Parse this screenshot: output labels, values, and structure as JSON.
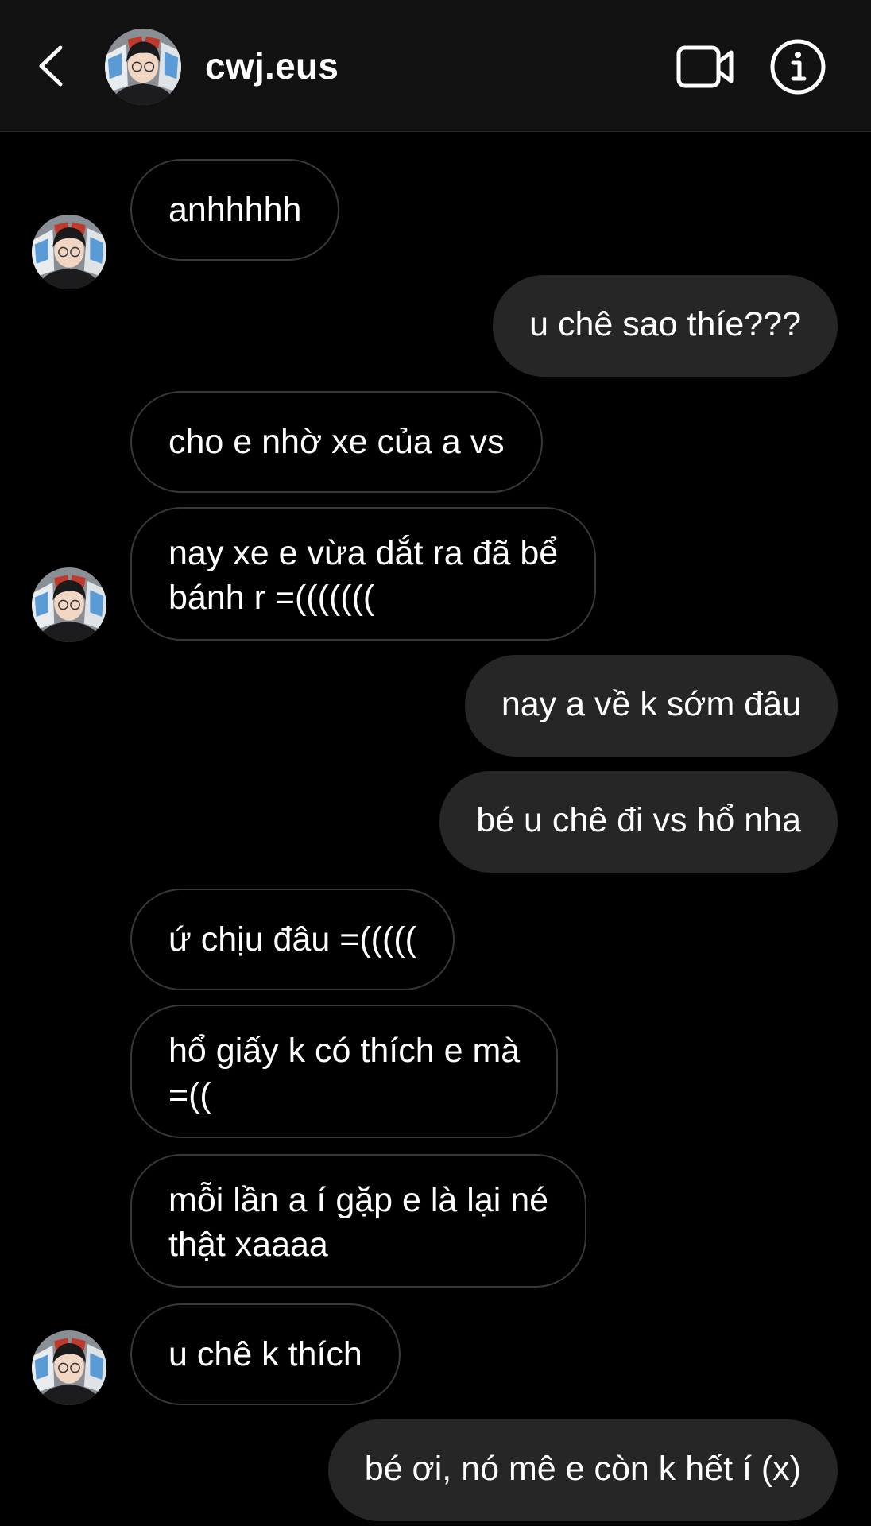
{
  "header": {
    "username": "cwj.eus",
    "back_icon": "chevron-left-icon",
    "video_icon": "video-camera-icon",
    "info_icon": "info-icon"
  },
  "colors": {
    "background": "#000000",
    "header_background": "#121212",
    "outgoing_bubble": "#262626",
    "incoming_border": "#383838",
    "text": "#ffffff"
  },
  "messages": [
    {
      "direction": "in",
      "text": "anhhhhh"
    },
    {
      "direction": "out",
      "text": "u chê sao thíe???"
    },
    {
      "direction": "in",
      "text": "cho e nhờ xe của a vs"
    },
    {
      "direction": "in",
      "text": "nay xe e vừa dắt ra đã bể\nbánh r =((((((("
    },
    {
      "direction": "out",
      "text": "nay a về k sớm đâu"
    },
    {
      "direction": "out",
      "text": "bé u chê đi vs hổ nha"
    },
    {
      "direction": "in",
      "text": "ứ chịu đâu =((((("
    },
    {
      "direction": "in",
      "text": "hổ giấy k có thích e mà\n=(("
    },
    {
      "direction": "in",
      "text": "mỗi lần a í gặp e là lại né\nthật xaaaa"
    },
    {
      "direction": "in",
      "text": "u chê k thích"
    },
    {
      "direction": "out",
      "text": "bé ơi, nó mê e còn k hết í (x)"
    }
  ]
}
